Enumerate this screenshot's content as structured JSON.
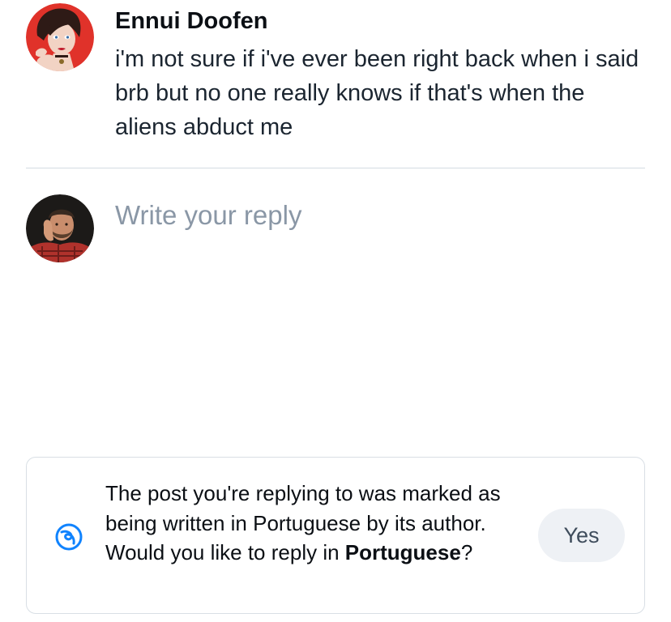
{
  "parent_post": {
    "author_name": "Ennui Doofen",
    "text": "i'm not sure if i've ever been right back when i said brb but no one really knows if that's when the aliens abduct me",
    "avatar_icon": "cartoon-woman-avatar"
  },
  "reply": {
    "placeholder": "Write your reply",
    "avatar_icon": "user-photo-avatar"
  },
  "language_prompt": {
    "icon": "translate-language-icon",
    "text_before": "The post you're replying to was marked as being written in Portuguese by its author. Would you like to reply in ",
    "language": "Portuguese",
    "text_after": "?",
    "yes_label": "Yes"
  },
  "colors": {
    "accent": "#1083fe",
    "divider": "#d4dbe2",
    "placeholder": "#8a97a6",
    "button_bg": "#eef1f5"
  }
}
